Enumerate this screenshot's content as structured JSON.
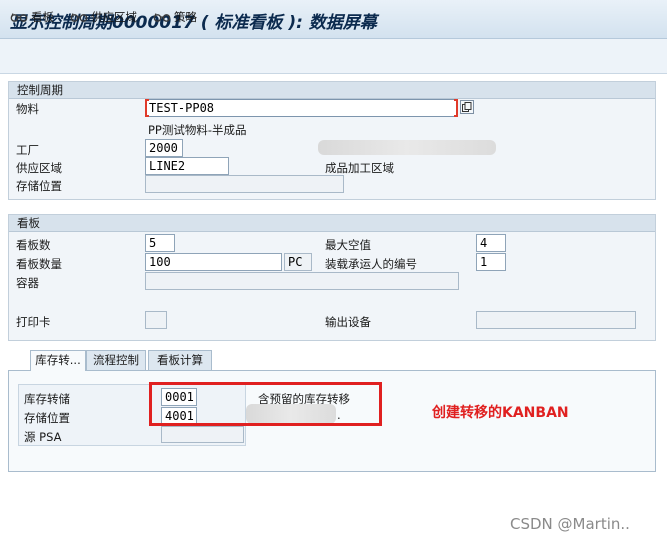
{
  "window": {
    "title": "显示控制周期0000017 ( 标准看板 ): 数据屏幕"
  },
  "toolbar": {
    "items": [
      {
        "label": "看板",
        "icon": "glasses-icon"
      },
      {
        "label": "供应区域",
        "icon": "glasses-icon"
      },
      {
        "label": "策略",
        "icon": "glasses-icon"
      }
    ]
  },
  "control_cycle": {
    "heading": "控制周期",
    "material_label": "物料",
    "material_value": "TEST-PP08",
    "material_desc": "PP测试物料-半成品",
    "plant_label": "工厂",
    "plant_value": "2000",
    "supply_area_label": "供应区域",
    "supply_area_value": "LINE2",
    "supply_area_desc": "成品加工区域",
    "storage_label": "存储位置",
    "storage_value": ""
  },
  "kanban": {
    "heading": "看板",
    "count_label": "看板数",
    "count_value": "5",
    "qty_label": "看板数量",
    "qty_value": "100",
    "qty_unit": "PC",
    "container_label": "容器",
    "container_value": "",
    "print_label": "打印卡",
    "max_empty_label": "最大空值",
    "max_empty_value": "4",
    "carrier_label": "装载承运人的编号",
    "carrier_value": "1",
    "output_label": "输出设备",
    "output_value": ""
  },
  "tabs": [
    {
      "label": "库存转..."
    },
    {
      "label": "流程控制"
    },
    {
      "label": "看板计算"
    }
  ],
  "transfer": {
    "stock_transfer_label": "库存转储",
    "stock_transfer_value": "0001",
    "stock_transfer_desc": "含预留的库存转移",
    "storage_label": "存储位置",
    "storage_value": "4001",
    "storage_desc_suffix": ".",
    "psa_label": "源 PSA",
    "psa_value": ""
  },
  "annotation": {
    "text": "创建转移的KANBAN",
    "color": "#e02020"
  },
  "watermark": {
    "text": "CSDN @Martin.."
  }
}
